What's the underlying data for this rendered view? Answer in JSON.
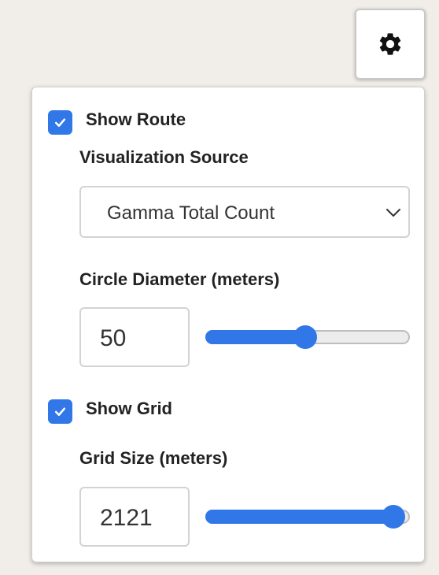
{
  "settings_button": {
    "icon": "gear-icon"
  },
  "route": {
    "show_label": "Show Route",
    "checked": true,
    "source_label": "Visualization Source",
    "source_value": "Gamma Total Count",
    "diameter_label": "Circle Diameter (meters)",
    "diameter_value": "50",
    "diameter_fraction": 0.49
  },
  "grid": {
    "show_label": "Show Grid",
    "checked": true,
    "size_label": "Grid Size (meters)",
    "size_value": "2121",
    "size_fraction": 0.92
  },
  "colors": {
    "accent": "#3277e8",
    "background": "#f1eee9"
  }
}
